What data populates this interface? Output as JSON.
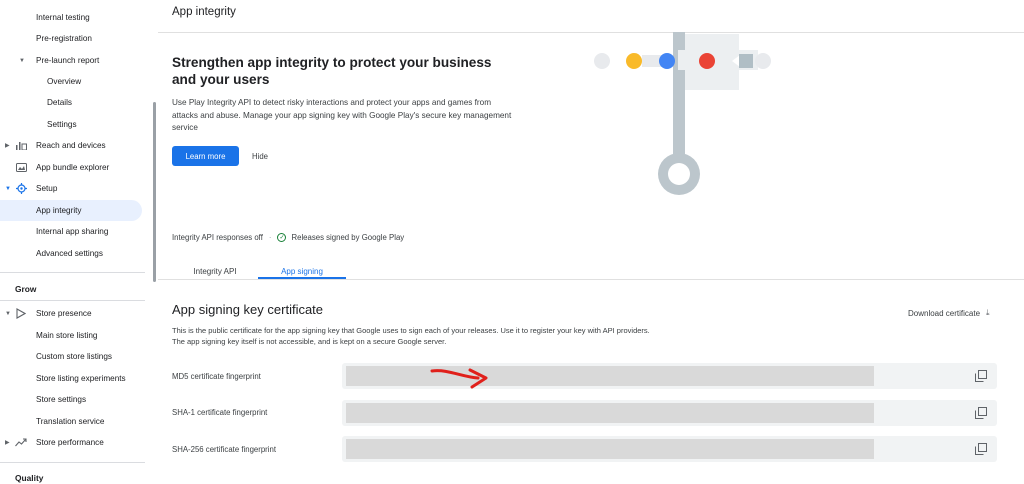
{
  "sidebar": {
    "items": [
      {
        "label": "Internal testing"
      },
      {
        "label": "Pre-registration"
      },
      {
        "label": "Pre-launch report"
      },
      {
        "label": "Overview"
      },
      {
        "label": "Details"
      },
      {
        "label": "Settings"
      },
      {
        "label": "Reach and devices",
        "icon": "bar-chart-icon"
      },
      {
        "label": "App bundle explorer",
        "icon": "bundle-icon"
      },
      {
        "label": "Setup",
        "icon": "gear-icon"
      },
      {
        "label": "App integrity"
      },
      {
        "label": "Internal app sharing"
      },
      {
        "label": "Advanced settings"
      }
    ],
    "grow_section": "Grow",
    "grow_items": [
      {
        "label": "Store presence",
        "icon": "play-icon"
      },
      {
        "label": "Main store listing"
      },
      {
        "label": "Custom store listings"
      },
      {
        "label": "Store listing experiments"
      },
      {
        "label": "Store settings"
      },
      {
        "label": "Translation service"
      },
      {
        "label": "Store performance",
        "icon": "trending-up-icon"
      }
    ],
    "quality_section": "Quality"
  },
  "header": {
    "title": "App integrity"
  },
  "hero": {
    "title": "Strengthen app integrity to protect your business and your users",
    "description": "Use Play Integrity API to detect risky interactions and protect your apps and games from attacks and abuse. Manage your app signing key with Google Play's secure key management service",
    "learn_more": "Learn more",
    "hide": "Hide"
  },
  "status": {
    "api": "Integrity API responses off",
    "separator": "·",
    "signing": "Releases signed by Google Play"
  },
  "tabs": [
    {
      "label": "Integrity API"
    },
    {
      "label": "App signing"
    }
  ],
  "certificate": {
    "title": "App signing key certificate",
    "download": "Download certificate",
    "description": "This is the public certificate for the app signing key that Google uses to sign each of your releases. Use it to register your key with API providers. The app signing key itself is not accessible, and is kept on a secure Google server.",
    "fingerprints": [
      {
        "label": "MD5 certificate fingerprint"
      },
      {
        "label": "SHA-1 certificate fingerprint"
      },
      {
        "label": "SHA-256 certificate fingerprint"
      }
    ]
  },
  "colors": {
    "accent": "#1a73e8",
    "active_bg": "#e8f0fe",
    "annotation_arrow": "#e0201b"
  }
}
